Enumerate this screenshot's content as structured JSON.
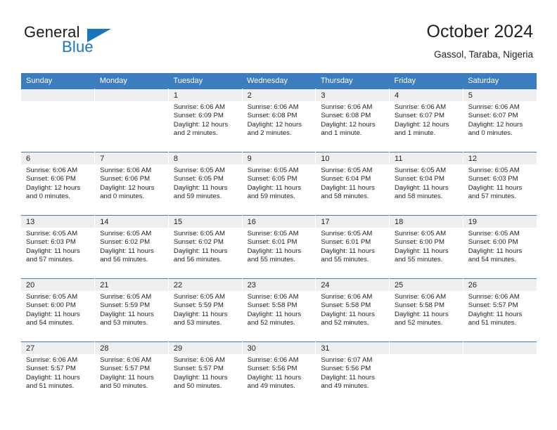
{
  "logo": {
    "word_top": "General",
    "word_bottom": "Blue",
    "triangle_icon": "blue-triangle-icon",
    "accent_color": "#1b75bb"
  },
  "header": {
    "title": "October 2024",
    "subtitle": "Gassol, Taraba, Nigeria"
  },
  "theme": {
    "header_row_color": "#3c7dbf",
    "daynum_strip_color": "#efefef",
    "text_color": "#231f20"
  },
  "calendar": {
    "weekday_headers": [
      "Sunday",
      "Monday",
      "Tuesday",
      "Wednesday",
      "Thursday",
      "Friday",
      "Saturday"
    ],
    "weeks": [
      [
        {
          "day": "",
          "lines": []
        },
        {
          "day": "",
          "lines": []
        },
        {
          "day": "1",
          "lines": [
            "Sunrise: 6:06 AM",
            "Sunset: 6:09 PM",
            "Daylight: 12 hours and 2 minutes."
          ]
        },
        {
          "day": "2",
          "lines": [
            "Sunrise: 6:06 AM",
            "Sunset: 6:08 PM",
            "Daylight: 12 hours and 2 minutes."
          ]
        },
        {
          "day": "3",
          "lines": [
            "Sunrise: 6:06 AM",
            "Sunset: 6:08 PM",
            "Daylight: 12 hours and 1 minute."
          ]
        },
        {
          "day": "4",
          "lines": [
            "Sunrise: 6:06 AM",
            "Sunset: 6:07 PM",
            "Daylight: 12 hours and 1 minute."
          ]
        },
        {
          "day": "5",
          "lines": [
            "Sunrise: 6:06 AM",
            "Sunset: 6:07 PM",
            "Daylight: 12 hours and 0 minutes."
          ]
        }
      ],
      [
        {
          "day": "6",
          "lines": [
            "Sunrise: 6:06 AM",
            "Sunset: 6:06 PM",
            "Daylight: 12 hours and 0 minutes."
          ]
        },
        {
          "day": "7",
          "lines": [
            "Sunrise: 6:06 AM",
            "Sunset: 6:06 PM",
            "Daylight: 12 hours and 0 minutes."
          ]
        },
        {
          "day": "8",
          "lines": [
            "Sunrise: 6:05 AM",
            "Sunset: 6:05 PM",
            "Daylight: 11 hours and 59 minutes."
          ]
        },
        {
          "day": "9",
          "lines": [
            "Sunrise: 6:05 AM",
            "Sunset: 6:05 PM",
            "Daylight: 11 hours and 59 minutes."
          ]
        },
        {
          "day": "10",
          "lines": [
            "Sunrise: 6:05 AM",
            "Sunset: 6:04 PM",
            "Daylight: 11 hours and 58 minutes."
          ]
        },
        {
          "day": "11",
          "lines": [
            "Sunrise: 6:05 AM",
            "Sunset: 6:04 PM",
            "Daylight: 11 hours and 58 minutes."
          ]
        },
        {
          "day": "12",
          "lines": [
            "Sunrise: 6:05 AM",
            "Sunset: 6:03 PM",
            "Daylight: 11 hours and 57 minutes."
          ]
        }
      ],
      [
        {
          "day": "13",
          "lines": [
            "Sunrise: 6:05 AM",
            "Sunset: 6:03 PM",
            "Daylight: 11 hours and 57 minutes."
          ]
        },
        {
          "day": "14",
          "lines": [
            "Sunrise: 6:05 AM",
            "Sunset: 6:02 PM",
            "Daylight: 11 hours and 56 minutes."
          ]
        },
        {
          "day": "15",
          "lines": [
            "Sunrise: 6:05 AM",
            "Sunset: 6:02 PM",
            "Daylight: 11 hours and 56 minutes."
          ]
        },
        {
          "day": "16",
          "lines": [
            "Sunrise: 6:05 AM",
            "Sunset: 6:01 PM",
            "Daylight: 11 hours and 55 minutes."
          ]
        },
        {
          "day": "17",
          "lines": [
            "Sunrise: 6:05 AM",
            "Sunset: 6:01 PM",
            "Daylight: 11 hours and 55 minutes."
          ]
        },
        {
          "day": "18",
          "lines": [
            "Sunrise: 6:05 AM",
            "Sunset: 6:00 PM",
            "Daylight: 11 hours and 55 minutes."
          ]
        },
        {
          "day": "19",
          "lines": [
            "Sunrise: 6:05 AM",
            "Sunset: 6:00 PM",
            "Daylight: 11 hours and 54 minutes."
          ]
        }
      ],
      [
        {
          "day": "20",
          "lines": [
            "Sunrise: 6:05 AM",
            "Sunset: 6:00 PM",
            "Daylight: 11 hours and 54 minutes."
          ]
        },
        {
          "day": "21",
          "lines": [
            "Sunrise: 6:05 AM",
            "Sunset: 5:59 PM",
            "Daylight: 11 hours and 53 minutes."
          ]
        },
        {
          "day": "22",
          "lines": [
            "Sunrise: 6:05 AM",
            "Sunset: 5:59 PM",
            "Daylight: 11 hours and 53 minutes."
          ]
        },
        {
          "day": "23",
          "lines": [
            "Sunrise: 6:06 AM",
            "Sunset: 5:58 PM",
            "Daylight: 11 hours and 52 minutes."
          ]
        },
        {
          "day": "24",
          "lines": [
            "Sunrise: 6:06 AM",
            "Sunset: 5:58 PM",
            "Daylight: 11 hours and 52 minutes."
          ]
        },
        {
          "day": "25",
          "lines": [
            "Sunrise: 6:06 AM",
            "Sunset: 5:58 PM",
            "Daylight: 11 hours and 52 minutes."
          ]
        },
        {
          "day": "26",
          "lines": [
            "Sunrise: 6:06 AM",
            "Sunset: 5:57 PM",
            "Daylight: 11 hours and 51 minutes."
          ]
        }
      ],
      [
        {
          "day": "27",
          "lines": [
            "Sunrise: 6:06 AM",
            "Sunset: 5:57 PM",
            "Daylight: 11 hours and 51 minutes."
          ]
        },
        {
          "day": "28",
          "lines": [
            "Sunrise: 6:06 AM",
            "Sunset: 5:57 PM",
            "Daylight: 11 hours and 50 minutes."
          ]
        },
        {
          "day": "29",
          "lines": [
            "Sunrise: 6:06 AM",
            "Sunset: 5:57 PM",
            "Daylight: 11 hours and 50 minutes."
          ]
        },
        {
          "day": "30",
          "lines": [
            "Sunrise: 6:06 AM",
            "Sunset: 5:56 PM",
            "Daylight: 11 hours and 49 minutes."
          ]
        },
        {
          "day": "31",
          "lines": [
            "Sunrise: 6:07 AM",
            "Sunset: 5:56 PM",
            "Daylight: 11 hours and 49 minutes."
          ]
        },
        {
          "day": "",
          "lines": []
        },
        {
          "day": "",
          "lines": []
        }
      ]
    ]
  }
}
